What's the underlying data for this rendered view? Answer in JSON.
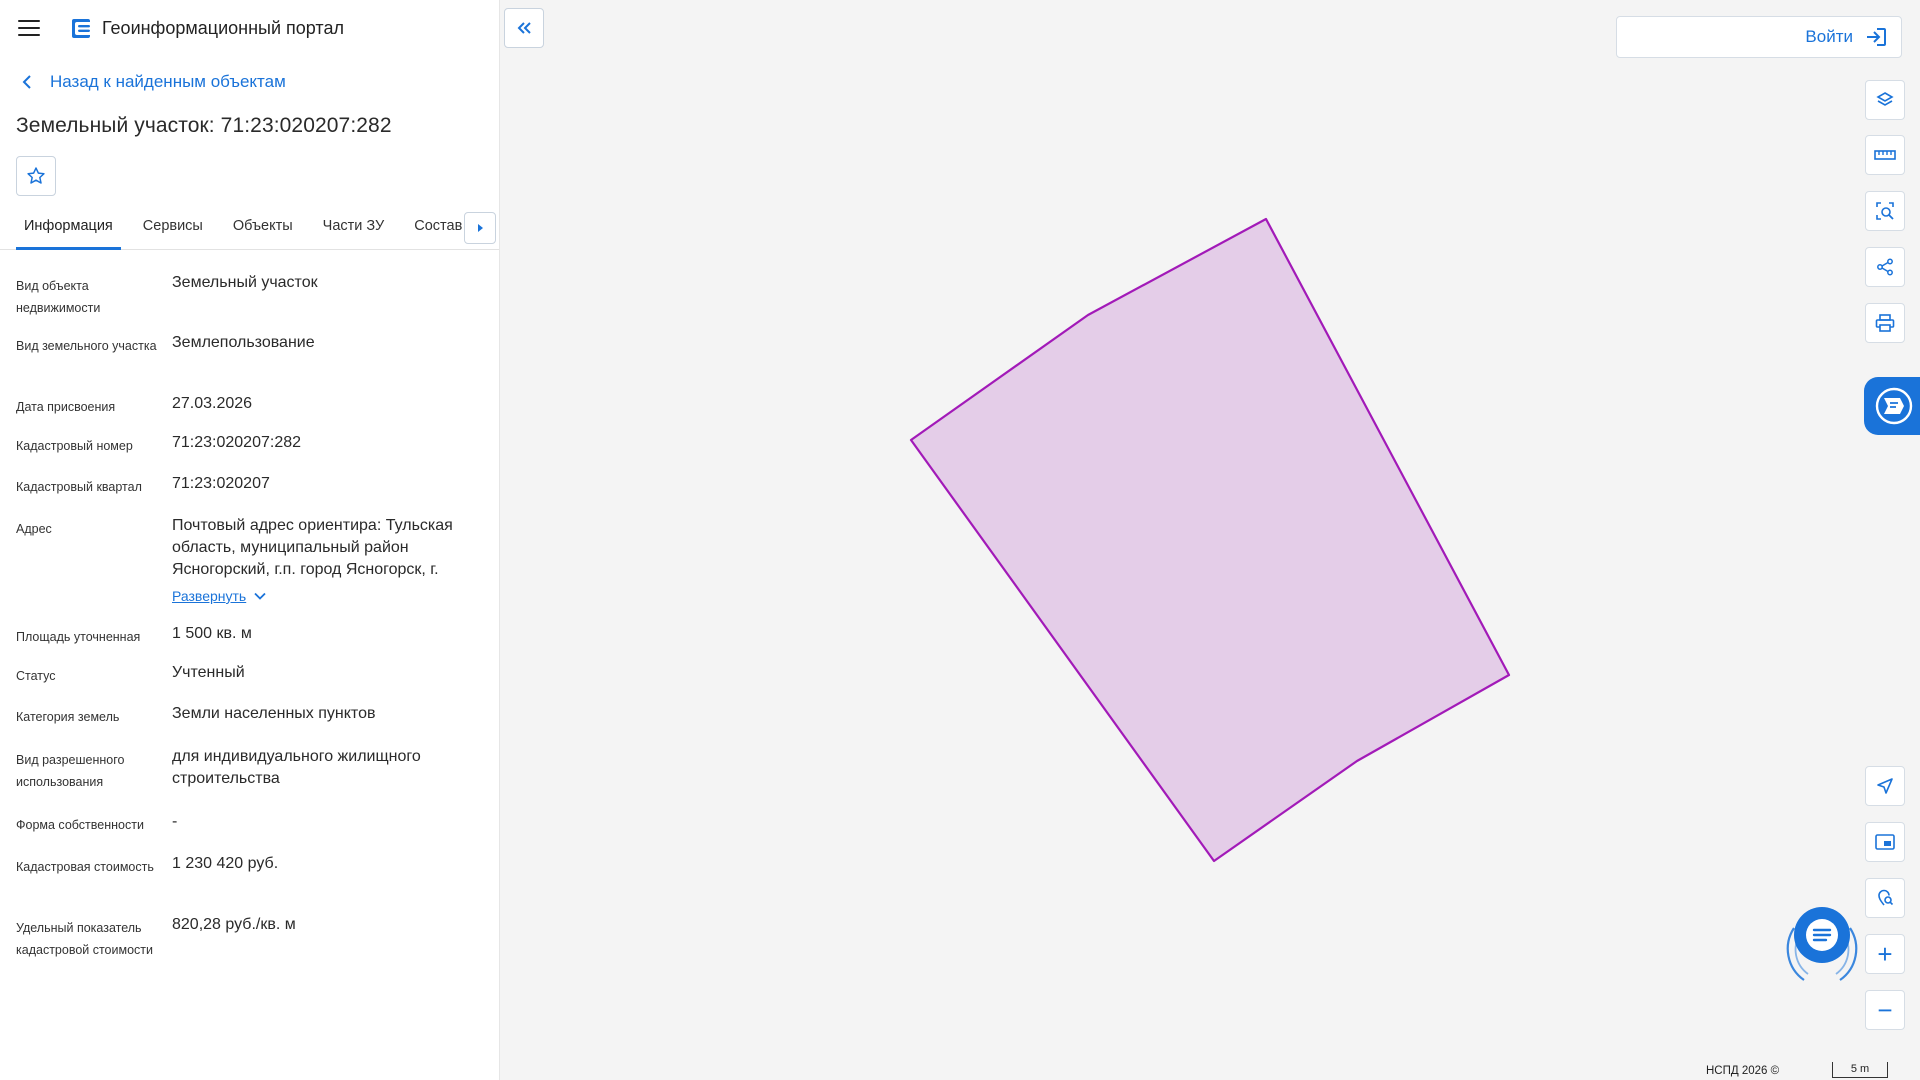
{
  "app": {
    "title": "Геоинформационный портал"
  },
  "nav": {
    "back_label": "Назад к найденным объектам"
  },
  "object": {
    "title": "Земельный участок: 71:23:020207:282"
  },
  "tabs": [
    {
      "label": "Информация",
      "active": true
    },
    {
      "label": "Сервисы"
    },
    {
      "label": "Объекты"
    },
    {
      "label": "Части ЗУ"
    },
    {
      "label": "Состав"
    }
  ],
  "properties": [
    {
      "label": "Вид объекта недвижимости",
      "value": "Земельный участок"
    },
    {
      "label": "Вид земельного участка",
      "value": "Землепользование"
    },
    {
      "label": "Дата присвоения",
      "value": "27.03.2026"
    },
    {
      "label": "Кадастровый номер",
      "value": "71:23:020207:282"
    },
    {
      "label": "Кадастровый квартал",
      "value": "71:23:020207"
    },
    {
      "label": "Адрес",
      "value": "Почтовый адрес ориентира: Тульская область, муниципальный район Ясногорский, г.п. город Ясногорск, г.",
      "expand_label": "Развернуть"
    },
    {
      "label": "Площадь уточненная",
      "value": "1 500 кв. м"
    },
    {
      "label": "Статус",
      "value": "Учтенный"
    },
    {
      "label": "Категория земель",
      "value": "Земли населенных пунктов"
    },
    {
      "label": "Вид разрешенного использования",
      "value": "для индивидуального жилищного строительства"
    },
    {
      "label": "Форма собственности",
      "value": "-"
    },
    {
      "label": "Кадастровая стоимость",
      "value": "1 230 420 руб."
    },
    {
      "label": "Удельный показатель кадастровой стоимости",
      "value": "820,28 руб./кв. м"
    }
  ],
  "header": {
    "login_label": "Войти"
  },
  "map": {
    "toolbar_icons": [
      "layers-icon",
      "ruler-icon",
      "area-select-icon",
      "share-icon",
      "print-icon"
    ],
    "bottom_icons": [
      "locate-icon",
      "minimap-icon",
      "geo-search-icon"
    ],
    "zoom_in_label": "+",
    "zoom_out_label": "−",
    "copyright": "НСПД 2026 ©",
    "scale_label": "5 m",
    "parcel_fill": "#e4cde8",
    "parcel_stroke": "#a21ab8",
    "accent": "#1a73d9"
  }
}
